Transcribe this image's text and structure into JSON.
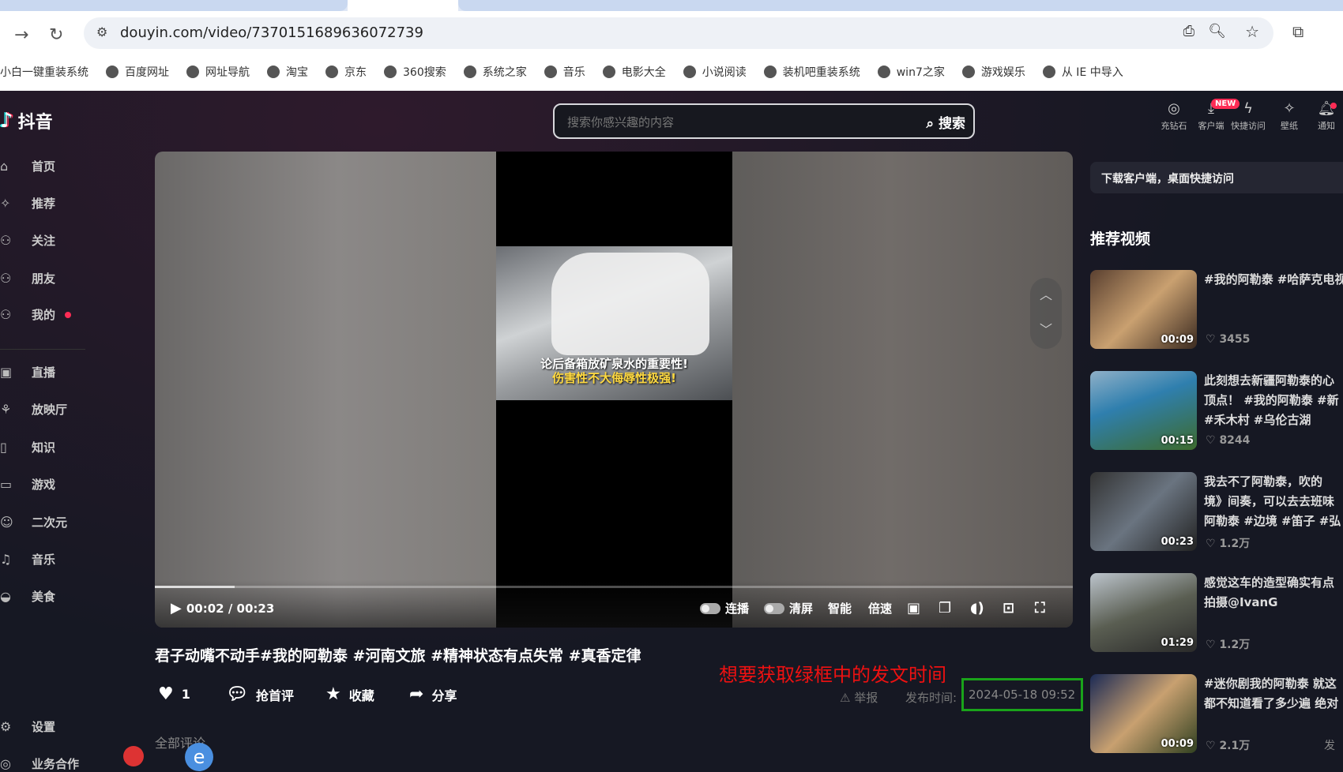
{
  "browser": {
    "url": "douyin.com/video/7370151689636072739",
    "bookmarks": [
      "小白一键重装系统",
      "百度网址",
      "网址导航",
      "淘宝",
      "京东",
      "360搜索",
      "系统之家",
      "音乐",
      "电影大全",
      "小说阅读",
      "装机吧重装系统",
      "win7之家",
      "游戏娱乐",
      "从 IE 中导入"
    ]
  },
  "header": {
    "logo": "抖音",
    "search_placeholder": "搜索你感兴趣的内容",
    "search_button": "搜索",
    "icons": [
      {
        "label": "充钻石",
        "icon": "diamond-icon"
      },
      {
        "label": "客户端",
        "icon": "download-icon"
      },
      {
        "label": "快捷访问",
        "icon": "lightning-icon"
      },
      {
        "label": "壁纸",
        "icon": "wallpaper-icon"
      },
      {
        "label": "通知",
        "icon": "bell-icon"
      }
    ],
    "new_badge": "NEW"
  },
  "sidebar": {
    "items": [
      "首页",
      "推荐",
      "关注",
      "朋友",
      "我的",
      "直播",
      "放映厅",
      "知识",
      "游戏",
      "二次元",
      "音乐",
      "美食"
    ],
    "settings": "设置",
    "business": "业务合作"
  },
  "video": {
    "caption1": "论后备箱放矿泉水的重要性!",
    "caption2": "伤害性不大侮辱性极强!",
    "time": "00:02 / 00:23",
    "progress": 0.087,
    "controls": [
      "连播",
      "清屏",
      "智能",
      "倍速"
    ],
    "title": "君子动嘴不动手#我的阿勒泰  #河南文旅  #精神状态有点失常  #真香定律",
    "likes": "1",
    "comment": "抢首评",
    "favorite": "收藏",
    "share": "分享",
    "report": "举报",
    "publish_label": "发布时间:",
    "publish_time": "2024-05-18 09:52",
    "all_comments": "全部评论"
  },
  "annotation": "想要获取绿框中的发文时间",
  "right": {
    "download_banner": "下载客户端，桌面快捷访问",
    "title": "推荐视频",
    "videos": [
      {
        "text": "#我的阿勒泰 #哈萨克电视",
        "duration": "00:09",
        "likes": "3455"
      },
      {
        "text": "此刻想去新疆阿勒泰的心\n顶点！ #我的阿勒泰 #新\n#禾木村 #乌伦古湖",
        "duration": "00:15",
        "likes": "8244"
      },
      {
        "text": "我去不了阿勒泰，吹的\n境》间奏，可以去去班味\n阿勒泰 #边境 #笛子 #弘",
        "duration": "00:23",
        "likes": "1.2万"
      },
      {
        "text": "感觉这车的造型确实有点\n拍摄@IvanG",
        "duration": "01:29",
        "likes": "1.2万"
      },
      {
        "text": "#迷你剧我的阿勒泰 就这\n都不知道看了多少遍 绝对",
        "duration": "00:09",
        "likes": "2.1万"
      }
    ],
    "fade_text": "发"
  }
}
